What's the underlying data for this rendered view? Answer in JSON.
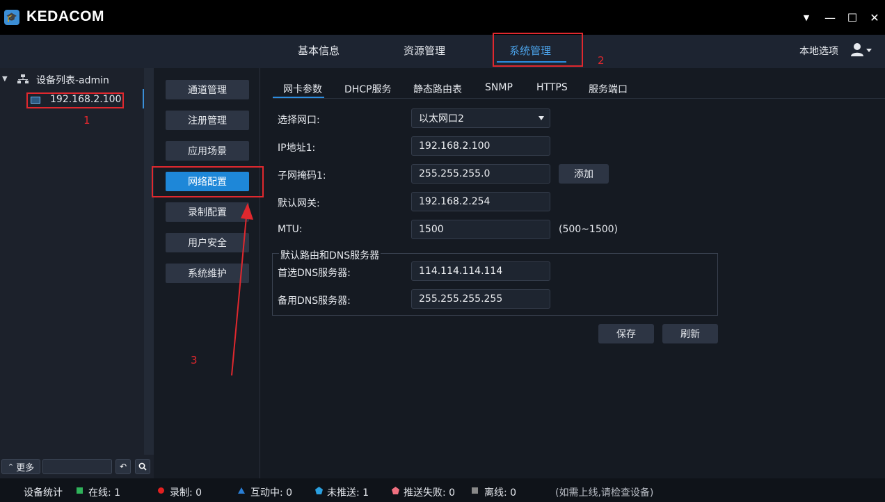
{
  "app": {
    "brand": "KEDACOM"
  },
  "window_controls": {
    "menu": "▼",
    "minimize": "—",
    "maximize": "☐",
    "close": "✕"
  },
  "nav": {
    "tabs": [
      {
        "label": "基本信息"
      },
      {
        "label": "资源管理"
      },
      {
        "label": "系统管理"
      }
    ],
    "local_options": "本地选项"
  },
  "tree": {
    "root": "设备列表-admin",
    "child": "192.168.2.100"
  },
  "left_footer": {
    "more": "更多",
    "search_placeholder": ""
  },
  "menu": {
    "items": [
      {
        "label": "通道管理"
      },
      {
        "label": "注册管理"
      },
      {
        "label": "应用场景"
      },
      {
        "label": "网络配置"
      },
      {
        "label": "录制配置"
      },
      {
        "label": "用户安全"
      },
      {
        "label": "系统维护"
      }
    ]
  },
  "subtabs": [
    {
      "label": "网卡参数"
    },
    {
      "label": "DHCP服务"
    },
    {
      "label": "静态路由表"
    },
    {
      "label": "SNMP"
    },
    {
      "label": "HTTPS"
    },
    {
      "label": "服务端口"
    }
  ],
  "form": {
    "select_port_label": "选择网口:",
    "select_port_value": "以太网口2",
    "ip_label": "IP地址1:",
    "ip_value": "192.168.2.100",
    "mask_label": "子网掩码1:",
    "mask_value": "255.255.255.0",
    "add_button": "添加",
    "gateway_label": "默认网关:",
    "gateway_value": "192.168.2.254",
    "mtu_label": "MTU:",
    "mtu_value": "1500",
    "mtu_range": "(500~1500)",
    "dns_group_title": "默认路由和DNS服务器",
    "dns1_label": "首选DNS服务器:",
    "dns1_value": "114.114.114.114",
    "dns2_label": "备用DNS服务器:",
    "dns2_value": "255.255.255.255",
    "save_button": "保存",
    "refresh_button": "刷新"
  },
  "status": {
    "title": "设备统计",
    "online": "在线: 1",
    "recording": "录制: 0",
    "interacting": "互动中: 0",
    "not_pushed": "未推送: 1",
    "push_failed": "推送失败: 0",
    "offline": "离线: 0",
    "hint": "(如需上线,请检查设备)"
  },
  "annotations": {
    "n1": "1",
    "n2": "2",
    "n3": "3"
  },
  "colors": {
    "accent": "#1e87d8",
    "online": "#2fb35a",
    "recording": "#e32020",
    "interacting": "#2a7fd6",
    "not_pushed": "#2aa0e0",
    "push_failed": "#f07080",
    "offline": "#888888",
    "annotation": "#e0282e"
  }
}
